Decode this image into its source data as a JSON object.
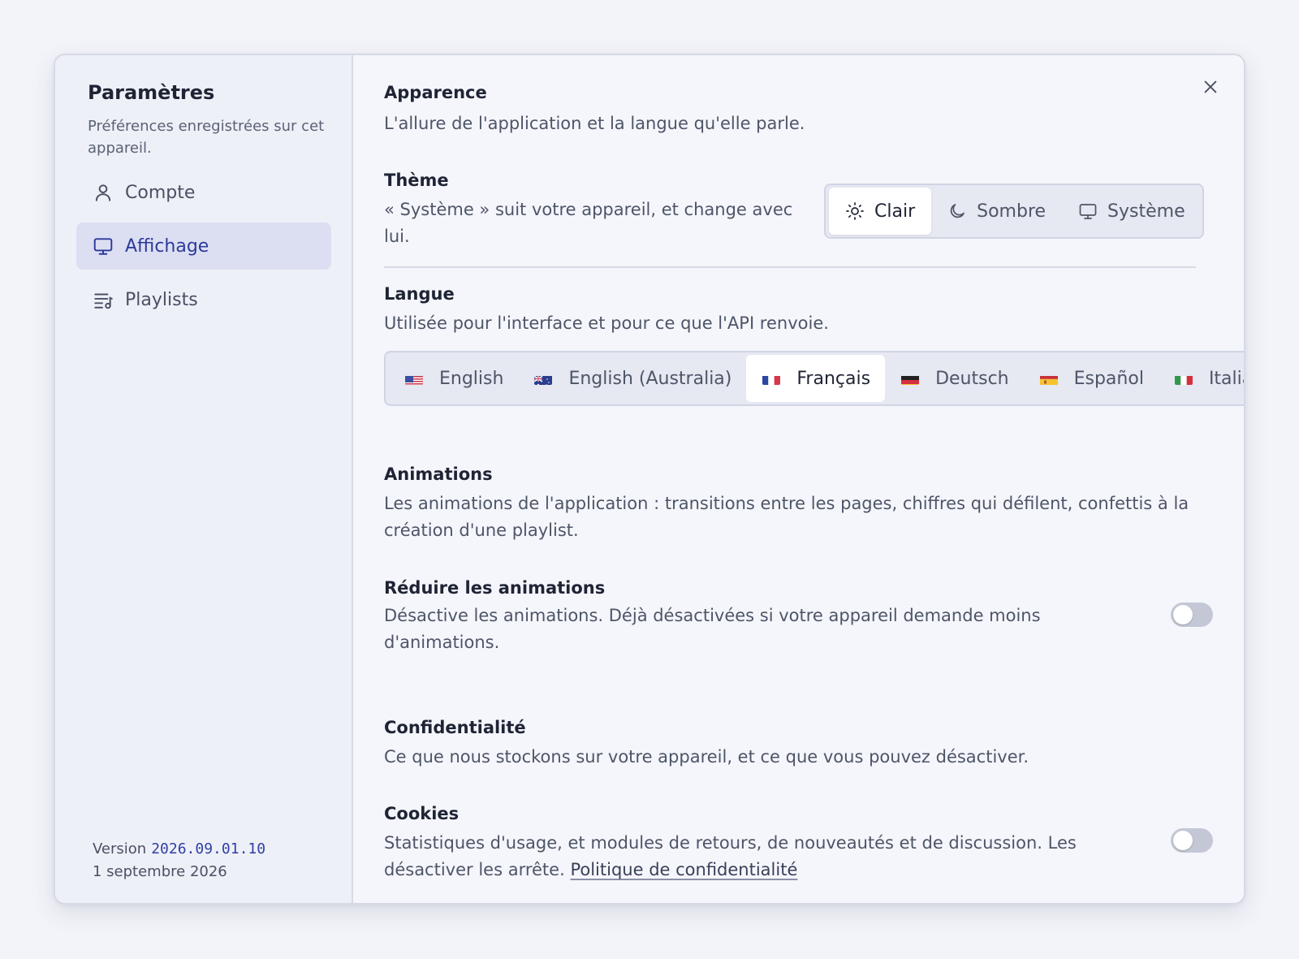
{
  "sidebar": {
    "title": "Paramètres",
    "subtitle": "Préférences enregistrées sur cet appareil.",
    "items": [
      {
        "label": "Compte",
        "icon": "user-icon"
      },
      {
        "label": "Affichage",
        "icon": "monitor-icon",
        "active": true
      },
      {
        "label": "Playlists",
        "icon": "playlist-icon"
      }
    ],
    "version_label": "Version",
    "version_number": "2026.09.01.10",
    "version_date": "1 septembre 2026"
  },
  "appearance": {
    "title": "Apparence",
    "description": "L'allure de l'application et la langue qu'elle parle.",
    "theme": {
      "title": "Thème",
      "description": "« Système » suit votre appareil, et change avec lui.",
      "options": [
        {
          "label": "Clair",
          "icon": "sun-icon",
          "selected": true
        },
        {
          "label": "Sombre",
          "icon": "moon-icon"
        },
        {
          "label": "Système",
          "icon": "monitor-icon"
        }
      ]
    },
    "language": {
      "title": "Langue",
      "description": "Utilisée pour l'interface et pour ce que l'API renvoie.",
      "options": [
        {
          "label": "English",
          "flag": "us-flag"
        },
        {
          "label": "English (Australia)",
          "flag": "au-flag"
        },
        {
          "label": "Français",
          "flag": "fr-flag",
          "selected": true
        },
        {
          "label": "Deutsch",
          "flag": "de-flag"
        },
        {
          "label": "Español",
          "flag": "es-flag"
        },
        {
          "label": "Italia",
          "flag": "it-flag"
        }
      ]
    }
  },
  "animations": {
    "title": "Animations",
    "description": "Les animations de l'application : transitions entre les pages, chiffres qui défilent, confettis à la création d'une playlist.",
    "reduce": {
      "title": "Réduire les animations",
      "description": "Désactive les animations. Déjà désactivées si votre appareil demande moins d'animations.",
      "enabled": false
    }
  },
  "privacy": {
    "title": "Confidentialité",
    "description": "Ce que nous stockons sur votre appareil, et ce que vous pouvez désactiver.",
    "cookies": {
      "title": "Cookies",
      "description": "Statistiques d'usage, et modules de retours, de nouveautés et de discussion. Les désactiver les arrête.",
      "link": "Politique de confidentialité",
      "enabled": false
    }
  },
  "colors": {
    "accent": "#2c3a9a",
    "active_nav_bg": "#dcdff2",
    "toggle_off": "#c4c8d6"
  }
}
